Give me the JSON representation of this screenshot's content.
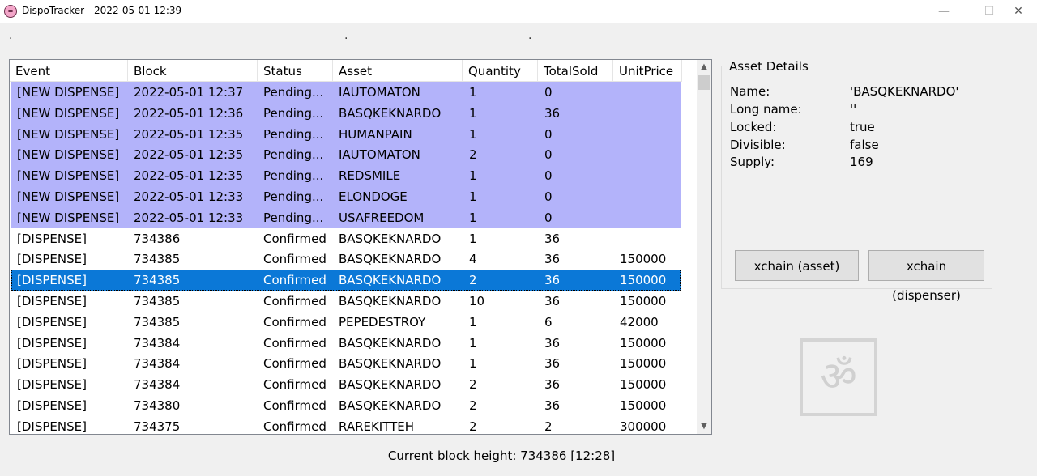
{
  "window": {
    "title": "DispoTracker - 2022-05-01 12:39",
    "minimize": "—",
    "maximize": "☐",
    "close": "✕"
  },
  "toolbar_dots": [
    ".",
    ".",
    "."
  ],
  "grid": {
    "columns": [
      "Event",
      "Block",
      "Status",
      "Asset",
      "Quantity",
      "TotalSold",
      "UnitPrice"
    ],
    "rows": [
      {
        "event": "[NEW DISPENSE]",
        "block": "2022-05-01 12:37",
        "status": "Pending...",
        "asset": "IAUTOMATON",
        "quantity": "1",
        "total_sold": "0",
        "unit_price": "",
        "state": "pending"
      },
      {
        "event": "[NEW DISPENSE]",
        "block": "2022-05-01 12:36",
        "status": "Pending...",
        "asset": "BASQKEKNARDO",
        "quantity": "1",
        "total_sold": "36",
        "unit_price": "",
        "state": "pending"
      },
      {
        "event": "[NEW DISPENSE]",
        "block": "2022-05-01 12:35",
        "status": "Pending...",
        "asset": "HUMANPAIN",
        "quantity": "1",
        "total_sold": "0",
        "unit_price": "",
        "state": "pending"
      },
      {
        "event": "[NEW DISPENSE]",
        "block": "2022-05-01 12:35",
        "status": "Pending...",
        "asset": "IAUTOMATON",
        "quantity": "2",
        "total_sold": "0",
        "unit_price": "",
        "state": "pending"
      },
      {
        "event": "[NEW DISPENSE]",
        "block": "2022-05-01 12:35",
        "status": "Pending...",
        "asset": "REDSMILE",
        "quantity": "1",
        "total_sold": "0",
        "unit_price": "",
        "state": "pending"
      },
      {
        "event": "[NEW DISPENSE]",
        "block": "2022-05-01 12:33",
        "status": "Pending...",
        "asset": "ELONDOGE",
        "quantity": "1",
        "total_sold": "0",
        "unit_price": "",
        "state": "pending"
      },
      {
        "event": "[NEW DISPENSE]",
        "block": "2022-05-01 12:33",
        "status": "Pending...",
        "asset": "USAFREEDOM",
        "quantity": "1",
        "total_sold": "0",
        "unit_price": "",
        "state": "pending"
      },
      {
        "event": "[DISPENSE]",
        "block": "734386",
        "status": "Confirmed",
        "asset": "BASQKEKNARDO",
        "quantity": "1",
        "total_sold": "36",
        "unit_price": "",
        "state": "normal"
      },
      {
        "event": "[DISPENSE]",
        "block": "734385",
        "status": "Confirmed",
        "asset": "BASQKEKNARDO",
        "quantity": "4",
        "total_sold": "36",
        "unit_price": "150000",
        "state": "normal"
      },
      {
        "event": "[DISPENSE]",
        "block": "734385",
        "status": "Confirmed",
        "asset": "BASQKEKNARDO",
        "quantity": "2",
        "total_sold": "36",
        "unit_price": "150000",
        "state": "selected"
      },
      {
        "event": "[DISPENSE]",
        "block": "734385",
        "status": "Confirmed",
        "asset": "BASQKEKNARDO",
        "quantity": "10",
        "total_sold": "36",
        "unit_price": "150000",
        "state": "normal"
      },
      {
        "event": "[DISPENSE]",
        "block": "734385",
        "status": "Confirmed",
        "asset": "PEPEDESTROY",
        "quantity": "1",
        "total_sold": "6",
        "unit_price": "42000",
        "state": "normal"
      },
      {
        "event": "[DISPENSE]",
        "block": "734384",
        "status": "Confirmed",
        "asset": "BASQKEKNARDO",
        "quantity": "1",
        "total_sold": "36",
        "unit_price": "150000",
        "state": "normal"
      },
      {
        "event": "[DISPENSE]",
        "block": "734384",
        "status": "Confirmed",
        "asset": "BASQKEKNARDO",
        "quantity": "1",
        "total_sold": "36",
        "unit_price": "150000",
        "state": "normal"
      },
      {
        "event": "[DISPENSE]",
        "block": "734384",
        "status": "Confirmed",
        "asset": "BASQKEKNARDO",
        "quantity": "2",
        "total_sold": "36",
        "unit_price": "150000",
        "state": "normal"
      },
      {
        "event": "[DISPENSE]",
        "block": "734380",
        "status": "Confirmed",
        "asset": "BASQKEKNARDO",
        "quantity": "2",
        "total_sold": "36",
        "unit_price": "150000",
        "state": "normal"
      },
      {
        "event": "[DISPENSE]",
        "block": "734375",
        "status": "Confirmed",
        "asset": "RAREKITTEH",
        "quantity": "2",
        "total_sold": "2",
        "unit_price": "300000",
        "state": "normal"
      }
    ],
    "scroll_up": "▲",
    "scroll_down": "▼"
  },
  "asset_details": {
    "legend": "Asset Details",
    "fields": [
      {
        "label": "Name:",
        "value": "'BASQKEKNARDO'"
      },
      {
        "label": "Long name:",
        "value": "''"
      },
      {
        "label": "Locked:",
        "value": "true"
      },
      {
        "label": "Divisible:",
        "value": "false"
      },
      {
        "label": "Supply:",
        "value": "169"
      }
    ],
    "xchain_asset_button": "xchain (asset)",
    "xchain_dispenser_button": "xchain (dispenser)"
  },
  "logo_glyph": "ॐ",
  "status_bar": {
    "text": "Current block height: 734386 [12:28]"
  },
  "colors": {
    "pending_row": "#b3b3fa",
    "selected_row": "#0b78d7"
  }
}
